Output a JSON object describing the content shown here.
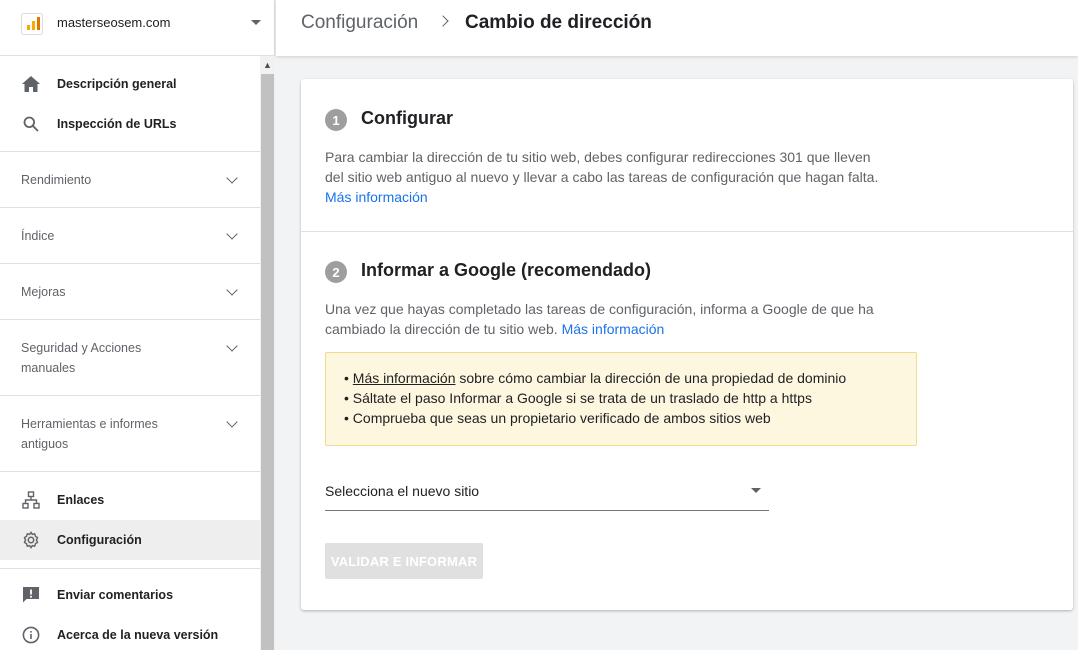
{
  "property": {
    "name": "masterseosem.com"
  },
  "nav": {
    "overview": "Descripción general",
    "url_inspection": "Inspección de URLs",
    "sections": [
      {
        "label": "Rendimiento"
      },
      {
        "label": "Índice"
      },
      {
        "label": "Mejoras"
      },
      {
        "label": "Seguridad y Acciones manuales"
      },
      {
        "label": "Herramientas e informes antiguos"
      }
    ],
    "links": "Enlaces",
    "settings": "Configuración",
    "feedback": "Enviar comentarios",
    "about": "Acerca de la nueva versión"
  },
  "header": {
    "breadcrumb_parent": "Configuración",
    "breadcrumb_current": "Cambio de dirección"
  },
  "step1": {
    "number": "1",
    "title": "Configurar",
    "text_line1": "Para cambiar la dirección de tu sitio web, debes configurar redirecciones 301 que lleven",
    "text_line2": "del sitio web antiguo al nuevo y llevar a cabo las tareas de configuración que hagan falta.",
    "link": "Más información"
  },
  "step2": {
    "number": "2",
    "title": "Informar a Google (recomendado)",
    "text_line1": "Una vez que hayas completado las tareas de configuración, informa a Google de que ha",
    "text_line2": "cambiado la dirección de tu sitio web.",
    "link": "Más información"
  },
  "notice": {
    "bullet": "•",
    "line1_link": "Más información",
    "line1_text": " sobre cómo cambiar la dirección de una propiedad de dominio",
    "line2": "Sáltate el paso Informar a Google si se trata de un traslado de http a https",
    "line3": "Comprueba que seas un propietario verificado de ambos sitios web"
  },
  "select": {
    "value": "Selecciona el nuevo sitio"
  },
  "button": {
    "label": "VALIDAR E INFORMAR"
  },
  "colors": {
    "accent": "#1a73e8",
    "notice_bg": "#fef7e0",
    "step_circle": "#9e9e9e"
  }
}
